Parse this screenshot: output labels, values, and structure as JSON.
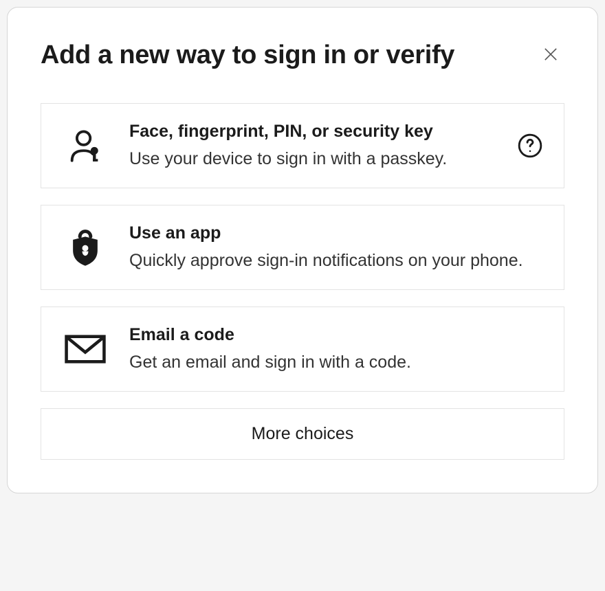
{
  "dialog": {
    "title": "Add a new way to sign in or verify",
    "close_label": "Close"
  },
  "options": [
    {
      "icon": "passkey-icon",
      "title": "Face, fingerprint, PIN, or security key",
      "description": "Use your device to sign in with a passkey.",
      "has_help": true
    },
    {
      "icon": "shield-lock-icon",
      "title": "Use an app",
      "description": "Quickly approve sign-in notifications on your phone.",
      "has_help": false
    },
    {
      "icon": "mail-icon",
      "title": "Email a code",
      "description": "Get an email and sign in with a  code.",
      "has_help": false
    }
  ],
  "more_choices_label": "More choices"
}
